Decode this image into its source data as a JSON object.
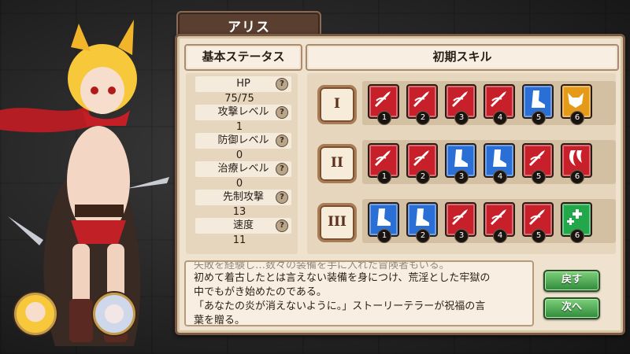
{
  "character_name": "アリス",
  "headers": {
    "base_status": "基本ステータス",
    "initial_skills": "初期スキル"
  },
  "stats": [
    {
      "label": "HP",
      "value": "75/75"
    },
    {
      "label": "攻撃レベル",
      "value": "1"
    },
    {
      "label": "防御レベル",
      "value": "0"
    },
    {
      "label": "治療レベル",
      "value": "0"
    },
    {
      "label": "先制攻撃",
      "value": "13"
    },
    {
      "label": "速度",
      "value": "11"
    }
  ],
  "help_glyph": "?",
  "tiers": [
    "I",
    "II",
    "III"
  ],
  "skill_rows": [
    {
      "cards": [
        {
          "num": "1",
          "color": "red",
          "icon": "slash-icon"
        },
        {
          "num": "2",
          "color": "red",
          "icon": "slash-icon"
        },
        {
          "num": "3",
          "color": "red",
          "icon": "slash-icon"
        },
        {
          "num": "4",
          "color": "red",
          "icon": "slash-icon"
        },
        {
          "num": "5",
          "color": "blue",
          "icon": "boot-icon"
        },
        {
          "num": "6",
          "color": "orange",
          "icon": "cat-icon"
        }
      ]
    },
    {
      "cards": [
        {
          "num": "1",
          "color": "red",
          "icon": "slash-icon"
        },
        {
          "num": "2",
          "color": "red",
          "icon": "slash-icon"
        },
        {
          "num": "3",
          "color": "blue",
          "icon": "boot-icon"
        },
        {
          "num": "4",
          "color": "blue",
          "icon": "boot-icon"
        },
        {
          "num": "5",
          "color": "red",
          "icon": "slash-icon"
        },
        {
          "num": "6",
          "color": "red",
          "icon": "claw-icon"
        }
      ]
    },
    {
      "cards": [
        {
          "num": "1",
          "color": "blue",
          "icon": "boot-icon"
        },
        {
          "num": "2",
          "color": "blue",
          "icon": "boot-icon"
        },
        {
          "num": "3",
          "color": "red",
          "icon": "slash-icon"
        },
        {
          "num": "4",
          "color": "red",
          "icon": "slash-icon"
        },
        {
          "num": "5",
          "color": "red",
          "icon": "slash-icon"
        },
        {
          "num": "6",
          "color": "green",
          "icon": "heal-plus-icon"
        }
      ]
    }
  ],
  "description_lines": [
    "失敗を経験し…数々の装備を手に入れた冒険者もいる。",
    "初めて着古したとは言えない装備を身につけ、荒淫とした牢獄の",
    "中でもがき始めたのである。",
    "「あなたの炎が消えないように。」ストーリーテラーが祝福の言",
    "葉を贈る。"
  ],
  "buttons": {
    "back": "戻す",
    "next": "次へ"
  },
  "colors": {
    "red": "#c8202a",
    "blue": "#2a6fd6",
    "orange": "#e59a1a",
    "green": "#22a84a"
  }
}
